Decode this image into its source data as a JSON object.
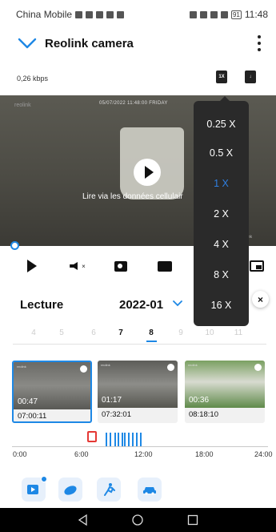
{
  "status_bar": {
    "carrier": "China Mobile",
    "battery": "91",
    "time": "11:48"
  },
  "app_bar": {
    "title": "Reolink camera"
  },
  "stream": {
    "bitrate": "0,26 kbps",
    "speed_icon_label": "1X"
  },
  "video": {
    "overlay_timestamp": "05/07/2022 11:48:00 FRIDAY",
    "message": "Lire via les données cellulair",
    "brand": "reolink"
  },
  "speed_menu": {
    "options": [
      "0.25 X",
      "0.5 X",
      "1 X",
      "2 X",
      "4 X",
      "8 X",
      "16 X"
    ],
    "selected_index": 2
  },
  "playback": {
    "title": "Lecture",
    "month": "2022-01",
    "close_label": "×",
    "days": [
      "4",
      "5",
      "6",
      "7",
      "8",
      "9",
      "10",
      "11"
    ],
    "days_with_recordings": [
      "7",
      "8"
    ],
    "selected_day": "8"
  },
  "clips": [
    {
      "duration": "00:47",
      "start": "07:00:11",
      "selected": true
    },
    {
      "duration": "01:17",
      "start": "07:32:01",
      "selected": false
    },
    {
      "duration": "00:36",
      "start": "08:18:10",
      "selected": false
    }
  ],
  "timeline": {
    "labels": [
      "0:00",
      "6:00",
      "12:00",
      "18:00",
      "24:00"
    ]
  },
  "colors": {
    "accent": "#1e88e5",
    "marker": "#e53935",
    "menu_bg": "#2a2a2a"
  },
  "bottom_bar": {
    "icons": [
      "playback-events-icon",
      "cloud-icon",
      "person-detection-icon",
      "vehicle-detection-icon"
    ]
  },
  "nav": {
    "icons": [
      "back-icon",
      "home-icon",
      "recents-icon"
    ]
  }
}
